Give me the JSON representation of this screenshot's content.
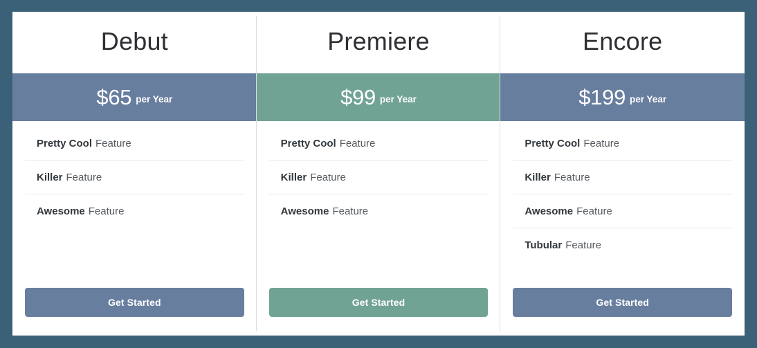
{
  "theme": {
    "page_background": "#3b6178",
    "card_background": "#ffffff",
    "accent_blue": "#687e9f",
    "accent_green": "#70a394",
    "divider": "#dcdcdc",
    "feature_rule": "#e8e8e8"
  },
  "plans": [
    {
      "name": "Debut",
      "price": "$65",
      "period": "per Year",
      "accent": "blue",
      "features": [
        {
          "name": "Pretty Cool",
          "suffix": "Feature"
        },
        {
          "name": "Killer",
          "suffix": "Feature"
        },
        {
          "name": "Awesome",
          "suffix": "Feature"
        }
      ],
      "cta_label": "Get Started"
    },
    {
      "name": "Premiere",
      "price": "$99",
      "period": "per Year",
      "accent": "green",
      "features": [
        {
          "name": "Pretty Cool",
          "suffix": "Feature"
        },
        {
          "name": "Killer",
          "suffix": "Feature"
        },
        {
          "name": "Awesome",
          "suffix": "Feature"
        }
      ],
      "cta_label": "Get Started"
    },
    {
      "name": "Encore",
      "price": "$199",
      "period": "per Year",
      "accent": "blue",
      "features": [
        {
          "name": "Pretty Cool",
          "suffix": "Feature"
        },
        {
          "name": "Killer",
          "suffix": "Feature"
        },
        {
          "name": "Awesome",
          "suffix": "Feature"
        },
        {
          "name": "Tubular",
          "suffix": "Feature"
        }
      ],
      "cta_label": "Get Started"
    }
  ]
}
